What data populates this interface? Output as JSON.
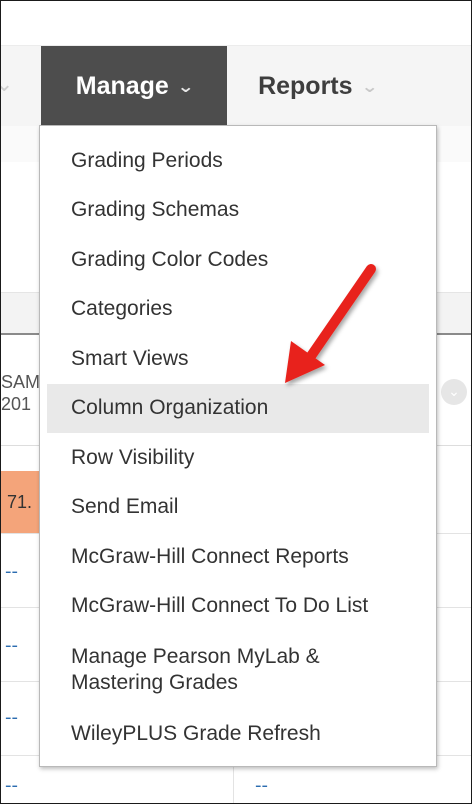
{
  "nav": {
    "tabs": [
      {
        "label": "Manage",
        "active": true,
        "icon": "chevron-down-icon"
      },
      {
        "label": "Reports",
        "active": false,
        "icon": "chevron-down-icon"
      }
    ]
  },
  "manage_menu": {
    "items": [
      {
        "label": "Grading Periods"
      },
      {
        "label": "Grading Schemas"
      },
      {
        "label": "Grading Color Codes"
      },
      {
        "label": "Categories"
      },
      {
        "label": "Smart Views"
      },
      {
        "label": "Column Organization",
        "highlighted": true
      },
      {
        "label": "Row Visibility"
      },
      {
        "label": "Send Email"
      },
      {
        "label": "McGraw-Hill Connect Reports"
      },
      {
        "label": "McGraw-Hill Connect To Do List"
      },
      {
        "label": "Manage Pearson MyLab & Mastering Grades"
      },
      {
        "label": "WileyPLUS Grade Refresh"
      }
    ]
  },
  "background_grid": {
    "column_header_line1": "SAM",
    "column_header_line2": "201",
    "orange_cell_value": "71.",
    "empty_marker": "--"
  },
  "colors": {
    "active_tab_bg": "#4d4d4d",
    "highlight_bg": "#e9e9e9",
    "arrow": "#e8211b",
    "orange_cell": "#f4a47a"
  }
}
